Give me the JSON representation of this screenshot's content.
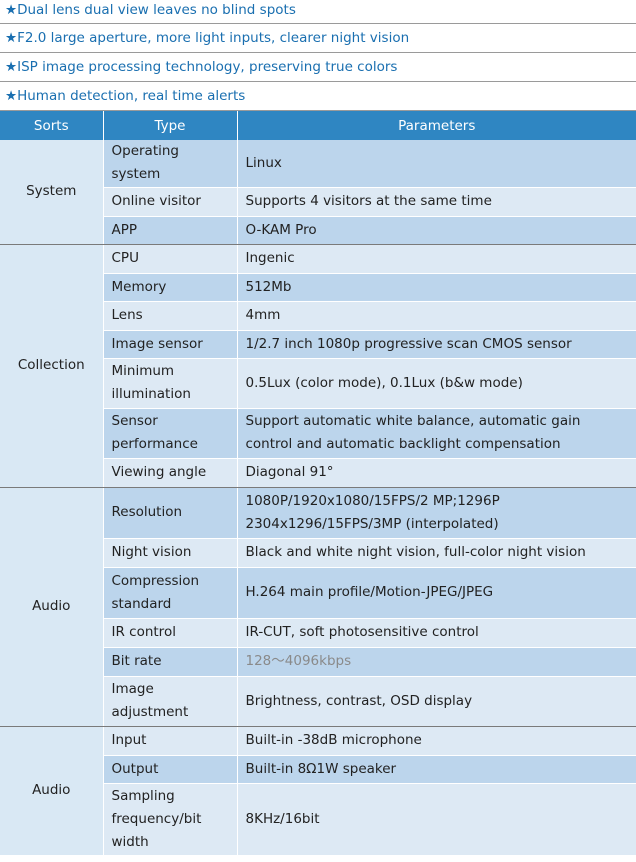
{
  "features": [
    "★Dual lens dual view leaves no blind spots",
    "★F2.0 large aperture, more light inputs, clearer night vision",
    "★ISP image processing technology, preserving true colors",
    "★Human detection, real time alerts"
  ],
  "table": {
    "headers": [
      "Sorts",
      "Type",
      "Parameters"
    ],
    "groups": [
      {
        "sort": "System",
        "rows": [
          {
            "type": "Operating system",
            "param": "Linux"
          },
          {
            "type": "Online visitor",
            "param": "Supports 4 visitors at the same time"
          },
          {
            "type": "APP",
            "param": "O-KAM Pro"
          }
        ]
      },
      {
        "sort": "Collection",
        "rows": [
          {
            "type": "CPU",
            "param": "Ingenic"
          },
          {
            "type": "Memory",
            "param": "512Mb"
          },
          {
            "type": "Lens",
            "param": "4mm"
          },
          {
            "type": "Image sensor",
            "param": "1/2.7 inch 1080p progressive scan CMOS sensor"
          },
          {
            "type": "Minimum illumination",
            "param": "0.5Lux (color mode), 0.1Lux (b&w mode)"
          },
          {
            "type": "Sensor performance",
            "param": "Support automatic white balance, automatic gain control and automatic backlight compensation"
          },
          {
            "type": "Viewing angle",
            "param": "Diagonal 91°"
          }
        ]
      },
      {
        "sort": "Audio",
        "rows": [
          {
            "type": "Resolution",
            "param": "1080P/1920x1080/15FPS/2 MP;1296P 2304x1296/15FPS/3MP (interpolated)"
          },
          {
            "type": "Night vision",
            "param": "Black and white night vision, full-color night vision"
          },
          {
            "type": "Compression standard",
            "param": "H.264 main profile/Motion-JPEG/JPEG"
          },
          {
            "type": "IR control",
            "param": "IR-CUT, soft photosensitive control"
          },
          {
            "type": "Bit rate",
            "param": "128～4096kbps"
          },
          {
            "type": "Image adjustment",
            "param": "Brightness, contrast, OSD display"
          }
        ]
      },
      {
        "sort": "Audio",
        "rows": [
          {
            "type": "Input",
            "param": "Built-in -38dB microphone"
          },
          {
            "type": "Output",
            "param": "Built-in 8Ω1W speaker"
          },
          {
            "type": "Sampling frequency/bit width",
            "param": "8KHz/16bit"
          }
        ]
      }
    ]
  }
}
